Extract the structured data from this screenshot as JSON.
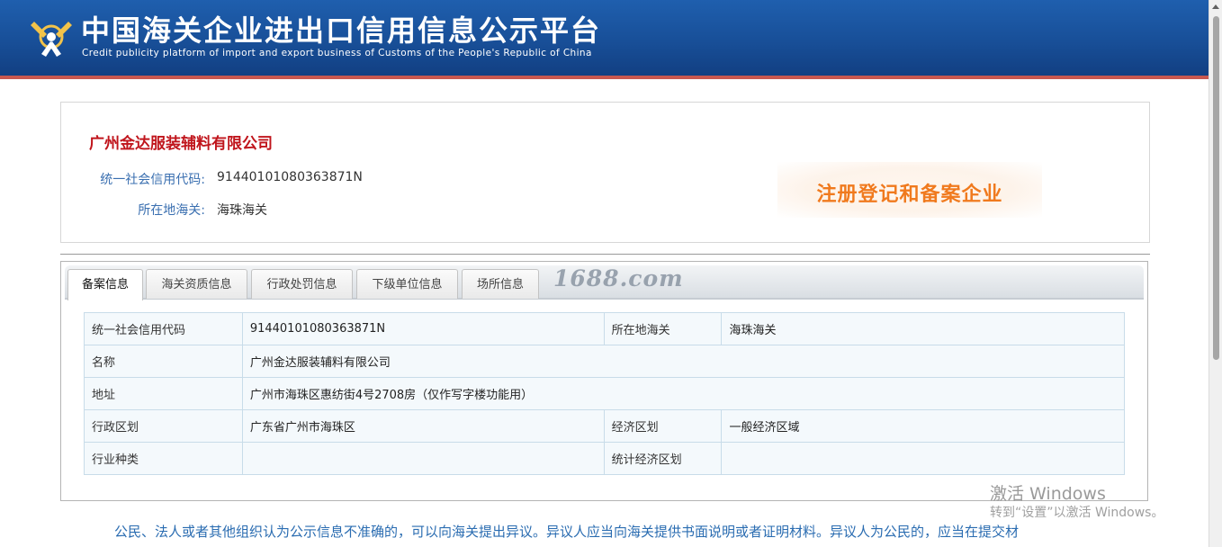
{
  "header": {
    "title": "中国海关企业进出口信用信息公示平台",
    "subtitle": "Credit publicity platform of import and export business of Customs of the People's Republic of China",
    "bg_color": "#184f98",
    "accent_color": "#c8574f"
  },
  "company": {
    "name": "广州金达服装辅料有限公司",
    "credit_code_label": "统一社会信用代码:",
    "credit_code": "91440101080363871N",
    "customs_label": "所在地海关:",
    "customs": "海珠海关",
    "stamp": "注册登记和备案企业"
  },
  "tabs": [
    {
      "label": "备案信息",
      "active": true
    },
    {
      "label": "海关资质信息",
      "active": false
    },
    {
      "label": "行政处罚信息",
      "active": false
    },
    {
      "label": "下级单位信息",
      "active": false
    },
    {
      "label": "场所信息",
      "active": false
    }
  ],
  "watermark": "1688.com",
  "detail": {
    "rows": [
      {
        "l1": "统一社会信用代码",
        "v1": "91440101080363871N",
        "l2": "所在地海关",
        "v2": "海珠海关"
      },
      {
        "l1": "名称",
        "v1": "广州金达服装辅料有限公司"
      },
      {
        "l1": "地址",
        "v1": "广州市海珠区惠纺街4号2708房（仅作写字楼功能用）"
      },
      {
        "l1": "行政区划",
        "v1": "广东省广州市海珠区",
        "l2": "经济区划",
        "v2": "一般经济区域"
      },
      {
        "l1": "行业种类",
        "v1": "",
        "l2": "统计经济区划",
        "v2": ""
      }
    ]
  },
  "os_overlay": {
    "activate": "激活 Windows",
    "hint": "转到“设置”以激活 Windows。"
  },
  "notice": "公民、法人或者其他组织认为公示信息不准确的，可以向海关提出异议。异议人应当向海关提供书面说明或者证明材料。异议人为公民的，应当在提交材"
}
